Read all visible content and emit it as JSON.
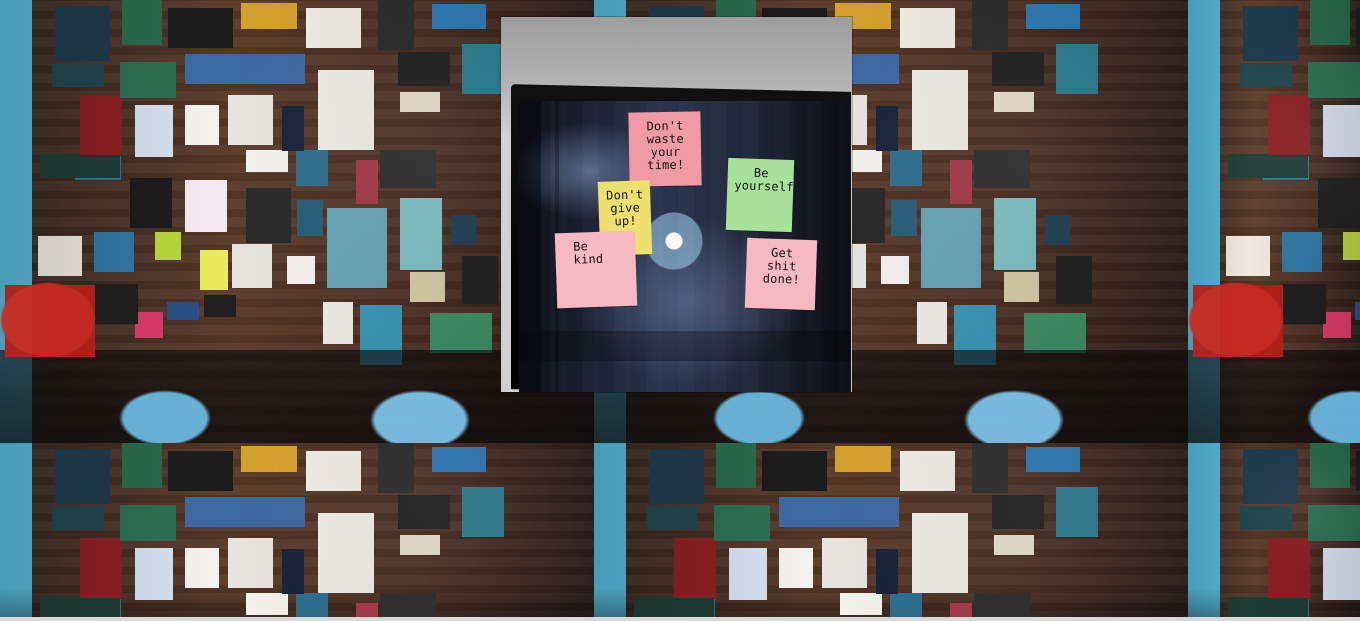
{
  "photo": {
    "notes": [
      {
        "text": "Don't\nwaste\nyour\ntime!"
      },
      {
        "text": "Don't\ngive\nup!"
      },
      {
        "text": "Be\nkind"
      },
      {
        "text": "Be\nyourself"
      },
      {
        "text": "Get\nshit\ndone!"
      }
    ]
  },
  "colors": {
    "note_pink": "#f09aa6",
    "note_light_pink": "#f6b8c1",
    "note_yellow": "#eee06e",
    "note_green": "#a7e19a",
    "accent_blue": "#56b7d6"
  }
}
